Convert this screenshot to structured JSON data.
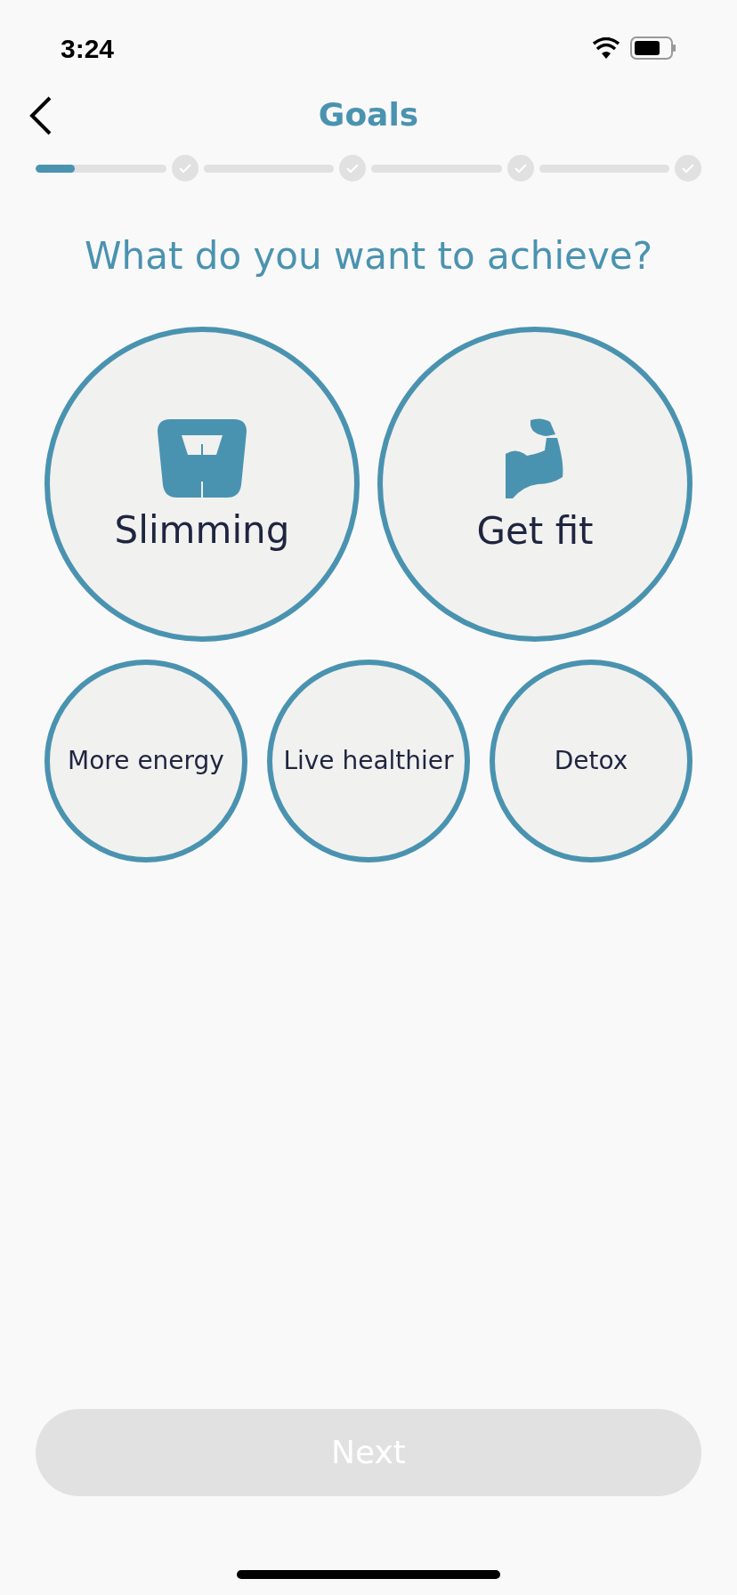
{
  "status_bar": {
    "time": "3:24"
  },
  "header": {
    "title": "Goals"
  },
  "progress": {
    "level": 0.3,
    "steps": [
      {
        "completed": false
      },
      {
        "completed": false
      },
      {
        "completed": false
      },
      {
        "completed": false
      }
    ]
  },
  "question": "What do you want to achieve?",
  "goals": [
    {
      "kind": "large",
      "label": "Slimming",
      "selected": false
    },
    {
      "kind": "large",
      "label": "Get fit",
      "selected": false
    },
    {
      "kind": "small",
      "label": "More energy",
      "selected": false
    },
    {
      "kind": "small",
      "label": "Live healthier",
      "selected": false
    },
    {
      "kind": "small",
      "label": "Detox",
      "selected": false
    }
  ],
  "next_button": {
    "label": "Next",
    "disabled": true
  }
}
